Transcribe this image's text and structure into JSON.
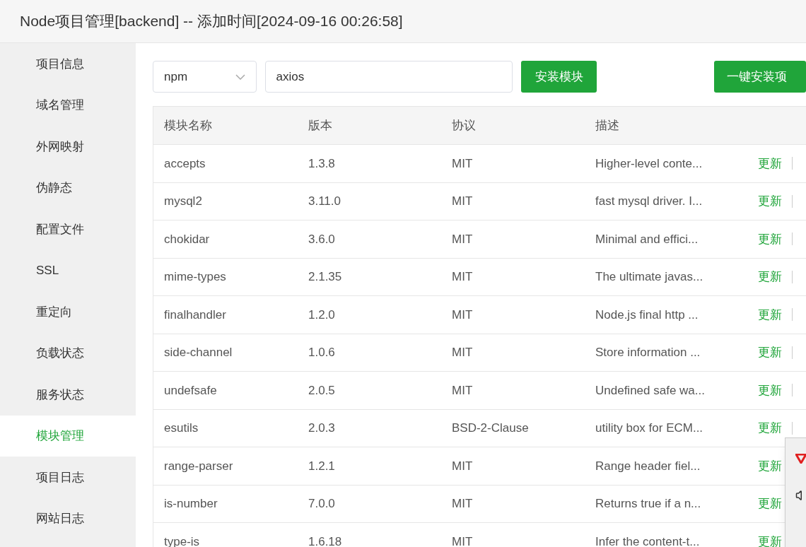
{
  "window": {
    "title": "Node项目管理[backend] -- 添加时间[2024-09-16 00:26:58]"
  },
  "sidebar": {
    "items": [
      {
        "label": "项目信息",
        "selected": false
      },
      {
        "label": "域名管理",
        "selected": false
      },
      {
        "label": "外网映射",
        "selected": false
      },
      {
        "label": "伪静态",
        "selected": false
      },
      {
        "label": "配置文件",
        "selected": false
      },
      {
        "label": "SSL",
        "selected": false
      },
      {
        "label": "重定向",
        "selected": false
      },
      {
        "label": "负载状态",
        "selected": false
      },
      {
        "label": "服务状态",
        "selected": false
      },
      {
        "label": "模块管理",
        "selected": true
      },
      {
        "label": "项目日志",
        "selected": false
      },
      {
        "label": "网站日志",
        "selected": false
      }
    ]
  },
  "toolbar": {
    "package_manager": "npm",
    "module_field": {
      "value": "axios"
    },
    "install_button": "安装模块",
    "install_all_button": "一键安装项"
  },
  "table": {
    "columns": [
      "模块名称",
      "版本",
      "协议",
      "描述"
    ],
    "rows": [
      {
        "name": "accepts",
        "version": "1.3.8",
        "license": "MIT",
        "description": "Higher-level conte...",
        "action": "更新"
      },
      {
        "name": "mysql2",
        "version": "3.11.0",
        "license": "MIT",
        "description": "fast mysql driver. I...",
        "action": "更新"
      },
      {
        "name": "chokidar",
        "version": "3.6.0",
        "license": "MIT",
        "description": "Minimal and effici...",
        "action": "更新"
      },
      {
        "name": "mime-types",
        "version": "2.1.35",
        "license": "MIT",
        "description": "The ultimate javas...",
        "action": "更新"
      },
      {
        "name": "finalhandler",
        "version": "1.2.0",
        "license": "MIT",
        "description": "Node.js final http ...",
        "action": "更新"
      },
      {
        "name": "side-channel",
        "version": "1.0.6",
        "license": "MIT",
        "description": "Store information ...",
        "action": "更新"
      },
      {
        "name": "undefsafe",
        "version": "2.0.5",
        "license": "MIT",
        "description": "Undefined safe wa...",
        "action": "更新"
      },
      {
        "name": "esutils",
        "version": "2.0.3",
        "license": "BSD-2-Clause",
        "description": "utility box for ECM...",
        "action": "更新"
      },
      {
        "name": "range-parser",
        "version": "1.2.1",
        "license": "MIT",
        "description": "Range header fiel...",
        "action": "更新"
      },
      {
        "name": "is-number",
        "version": "7.0.0",
        "license": "MIT",
        "description": "Returns true if a n...",
        "action": "更新"
      },
      {
        "name": "type-is",
        "version": "1.6.18",
        "license": "MIT",
        "description": "Infer the content-t...",
        "action": "更新"
      }
    ]
  }
}
